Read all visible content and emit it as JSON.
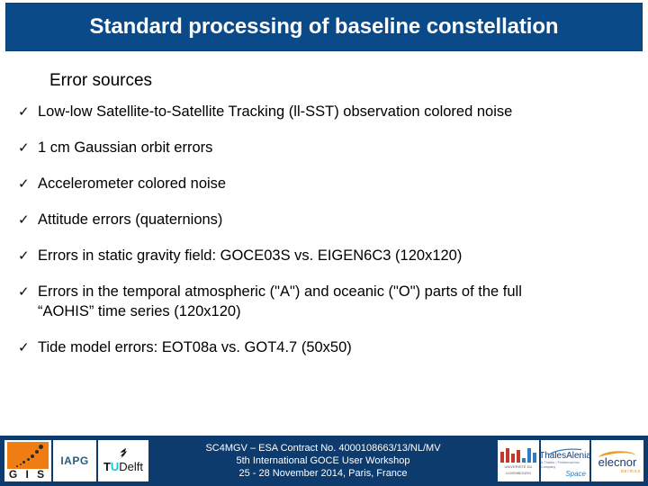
{
  "slide": {
    "title": "Standard processing of baseline constellation",
    "subheading": "Error sources",
    "bullet_marker": "✓",
    "bullets": [
      {
        "text": "Low-low Satellite-to-Satellite Tracking (ll-SST) observation colored noise"
      },
      {
        "text": "1 cm Gaussian orbit errors"
      },
      {
        "text": "Accelerometer colored noise"
      },
      {
        "text": "Attitude errors (quaternions)"
      },
      {
        "text": "Errors in static gravity field: GOCE03S vs. EIGEN6C3 (120x120)"
      },
      {
        "text": "Errors in the temporal atmospheric (\"A\") and oceanic (\"O\") parts of the full",
        "line2": "“AOHIS” time series  (120x120)"
      },
      {
        "text": "Tide model errors: EOT08a vs. GOT4.7 (50x50)"
      }
    ]
  },
  "footer": {
    "line1": "SC4MGV – ESA Contract No. 4000108663/13/NL/MV",
    "line2": "5th International GOCE User Workshop",
    "line3": "25 - 28 November 2014, Paris, France",
    "left_logos": [
      {
        "id": "gis-logo",
        "text": "G I S"
      },
      {
        "id": "iapg-logo",
        "text": "IAPG"
      },
      {
        "id": "tudelft-logo",
        "tu": "TU",
        "delft": "Delft"
      }
    ],
    "right_logos": [
      {
        "id": "uni-luxembourg-logo",
        "line1": "UNIVERSITÉ DU",
        "line2": "LUXEMBOURG"
      },
      {
        "id": "thales-alenia-space-logo",
        "name": "ThalesAlenia",
        "sub": "A Thales / Finmeccanica Company",
        "space": "Space"
      },
      {
        "id": "elecnor-deimos-logo",
        "name": "elecnor",
        "sub": "deimos"
      }
    ]
  },
  "colors": {
    "title_bar_blue": "#0b4a88",
    "footer_blue": "#0d3b6e",
    "gis_orange": "#f07d13",
    "tudelft_cyan": "#19c3e6",
    "elecnor_orange": "#e8a020",
    "text_black": "#000000"
  }
}
